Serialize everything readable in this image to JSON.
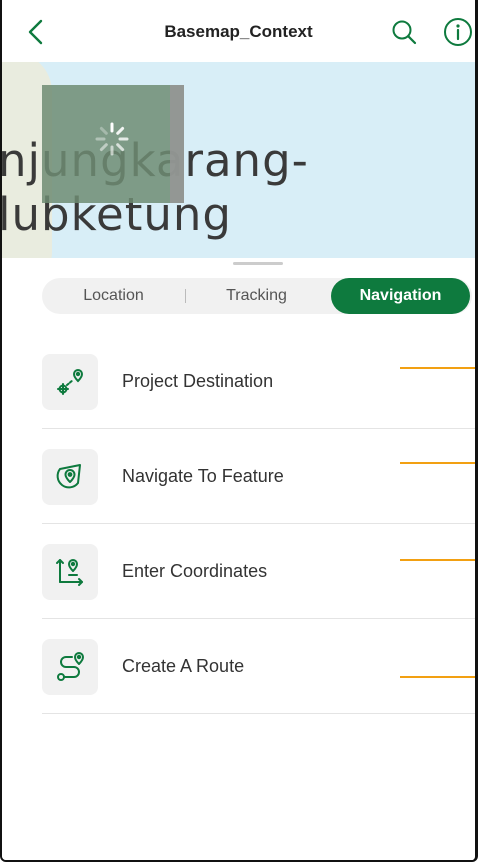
{
  "header": {
    "title": "Basemap_Context"
  },
  "map": {
    "label_line1": "njungkarang-",
    "label_line2": "lubketung"
  },
  "tabs": [
    {
      "label": "Location"
    },
    {
      "label": "Tracking"
    },
    {
      "label": "Navigation",
      "active": true
    }
  ],
  "navigation_items": [
    {
      "label": "Project Destination",
      "icon": "project-destination-icon"
    },
    {
      "label": "Navigate To Feature",
      "icon": "navigate-to-feature-icon"
    },
    {
      "label": "Enter Coordinates",
      "icon": "enter-coordinates-icon"
    },
    {
      "label": "Create A Route",
      "icon": "create-route-icon"
    }
  ],
  "colors": {
    "accent": "#0e7a3e",
    "highlight_line": "#f2a012",
    "map_water": "#d8eef7"
  }
}
